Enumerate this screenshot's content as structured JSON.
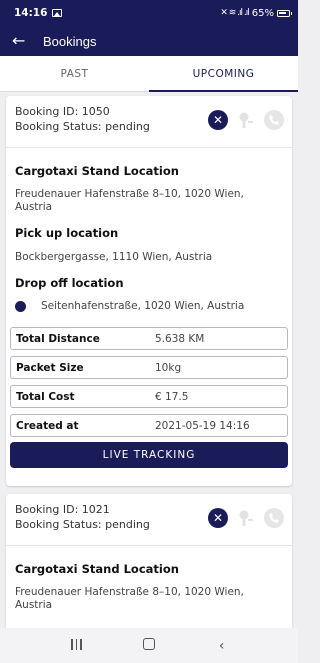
{
  "status_bar": {
    "time": "14:16",
    "battery": "65%",
    "signal_glyphs": "✕ ≋ .ıl .ıl"
  },
  "app_bar": {
    "back_icon": "arrow-left-icon",
    "title": "Bookings"
  },
  "tabs": [
    {
      "label": "PAST",
      "active": false
    },
    {
      "label": "UPCOMING",
      "active": true
    }
  ],
  "bookings": [
    {
      "id_line": "Booking ID: 1050",
      "status_line": "Booking Status: pending",
      "stand_title": "Cargotaxi Stand Location",
      "stand_address": "Freudenauer Hafenstraße 8–10, 1020 Wien, Austria",
      "pickup_title": "Pick up location",
      "pickup_address": "Bockbergergasse, 1110 Wien, Austria",
      "dropoff_title": "Drop off location",
      "dropoff_address": "Seitenhafenstraße, 1020 Wien, Austria",
      "details": [
        {
          "label": "Total Distance",
          "value": "5.638 KM"
        },
        {
          "label": "Packet Size",
          "value": "10kg"
        },
        {
          "label": "Total Cost",
          "value": "€ 17.5"
        },
        {
          "label": "Created at",
          "value": "2021-05-19 14:16"
        }
      ],
      "button_label": "LIVE TRACKING"
    },
    {
      "id_line": "Booking ID: 1021",
      "status_line": "Booking Status: pending",
      "stand_title": "Cargotaxi Stand Location",
      "stand_address": "Freudenauer Hafenstraße 8–10, 1020 Wien, Austria"
    }
  ],
  "colors": {
    "primary": "#1a1c5a",
    "background": "#efeff2"
  }
}
